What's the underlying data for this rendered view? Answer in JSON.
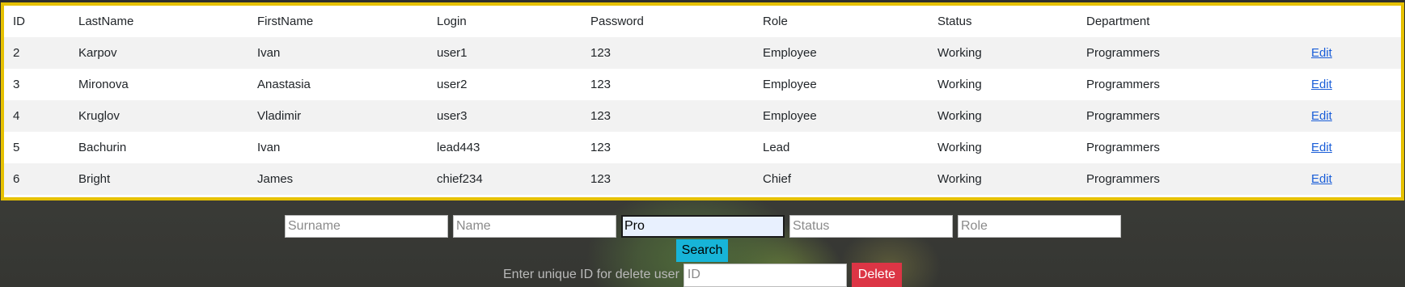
{
  "table": {
    "headers": [
      "ID",
      "LastName",
      "FirstName",
      "Login",
      "Password",
      "Role",
      "Status",
      "Department",
      ""
    ],
    "rows": [
      {
        "id": "2",
        "last": "Karpov",
        "first": "Ivan",
        "login": "user1",
        "password": "123",
        "role": "Employee",
        "status": "Working",
        "department": "Programmers",
        "action": "Edit"
      },
      {
        "id": "3",
        "last": "Mironova",
        "first": "Anastasia",
        "login": "user2",
        "password": "123",
        "role": "Employee",
        "status": "Working",
        "department": "Programmers",
        "action": "Edit"
      },
      {
        "id": "4",
        "last": "Kruglov",
        "first": "Vladimir",
        "login": "user3",
        "password": "123",
        "role": "Employee",
        "status": "Working",
        "department": "Programmers",
        "action": "Edit"
      },
      {
        "id": "5",
        "last": "Bachurin",
        "first": "Ivan",
        "login": "lead443",
        "password": "123",
        "role": "Lead",
        "status": "Working",
        "department": "Programmers",
        "action": "Edit"
      },
      {
        "id": "6",
        "last": "Bright",
        "first": "James",
        "login": "chief234",
        "password": "123",
        "role": "Chief",
        "status": "Working",
        "department": "Programmers",
        "action": "Edit"
      }
    ]
  },
  "search": {
    "surname_placeholder": "Surname",
    "name_placeholder": "Name",
    "department_value": "Pro",
    "status_placeholder": "Status",
    "role_placeholder": "Role",
    "button_label": "Search"
  },
  "delete": {
    "label": "Enter unique ID for delete user",
    "id_placeholder": "ID",
    "button_label": "Delete"
  },
  "colors": {
    "table_border": "#e6c100",
    "search_button": "#17b4d8",
    "delete_button": "#dc3545",
    "link": "#1a5ed8"
  }
}
